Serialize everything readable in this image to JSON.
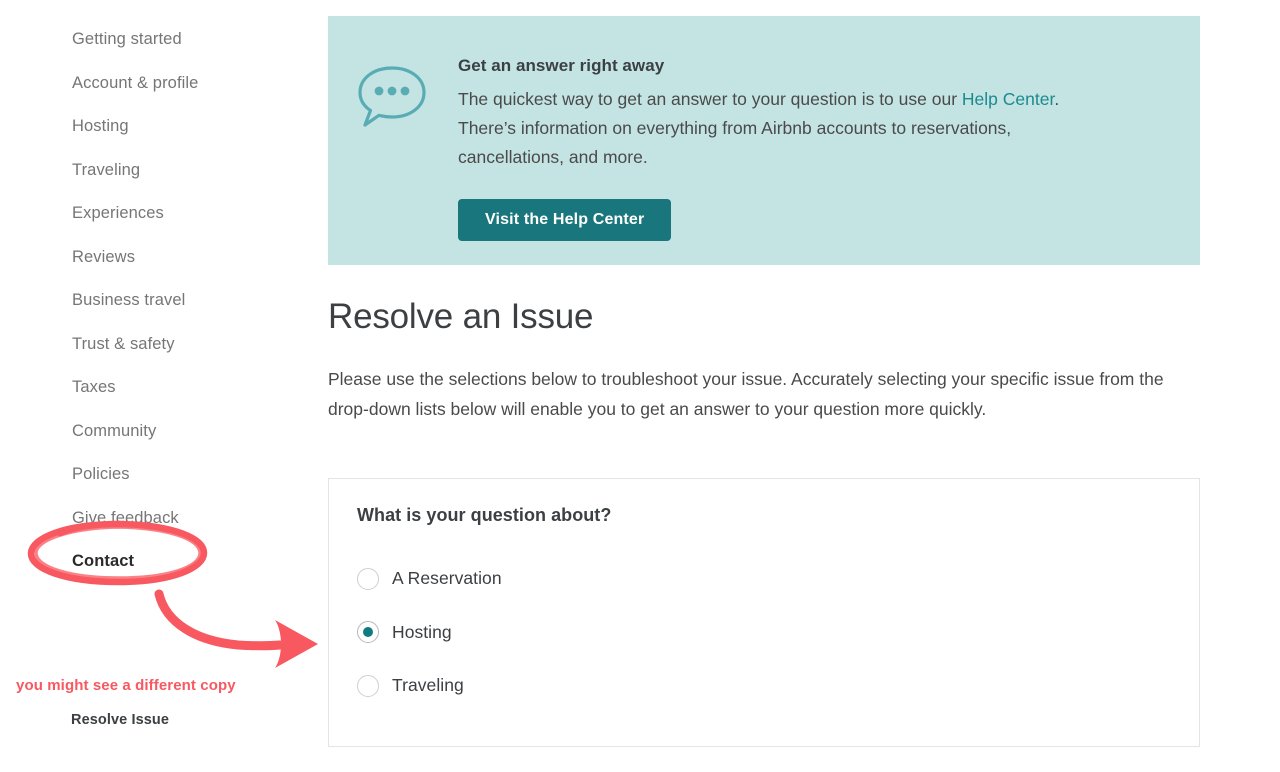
{
  "sidebar": {
    "items": [
      {
        "label": "Getting started",
        "active": false
      },
      {
        "label": "Account & profile",
        "active": false
      },
      {
        "label": "Hosting",
        "active": false
      },
      {
        "label": "Traveling",
        "active": false
      },
      {
        "label": "Experiences",
        "active": false
      },
      {
        "label": "Reviews",
        "active": false
      },
      {
        "label": "Business travel",
        "active": false
      },
      {
        "label": "Trust & safety",
        "active": false
      },
      {
        "label": "Taxes",
        "active": false
      },
      {
        "label": "Community",
        "active": false
      },
      {
        "label": "Policies",
        "active": false
      },
      {
        "label": "Give feedback",
        "active": false
      },
      {
        "label": "Contact",
        "active": true
      }
    ]
  },
  "annotations": {
    "color": "#f8585f",
    "note": "you might see a different copy",
    "sub_note": "Resolve Issue",
    "ellipse_target": "Contact",
    "arrow": "curved-arrow-right"
  },
  "banner": {
    "icon": "speech-bubble-ellipsis-icon",
    "background_color": "#c3e4e3",
    "title": "Get an answer right away",
    "text_before_link": "The quickest way to get an answer to your question is to use our ",
    "link_text": "Help Center",
    "text_after_link": ". There’s information on everything from Airbnb accounts to reservations, cancellations, and more.",
    "button_label": "Visit the Help Center",
    "button_color": "#19767c",
    "link_color": "#1d8a8f"
  },
  "main": {
    "title": "Resolve an Issue",
    "intro": "Please use the selections below to troubleshoot your issue. Accurately selecting your specific issue from the drop-down lists below will enable you to get an answer to your question more quickly."
  },
  "question_card": {
    "title": "What is your question about?",
    "selected_value": "Hosting",
    "options": [
      {
        "label": "A Reservation",
        "selected": false
      },
      {
        "label": "Hosting",
        "selected": true
      },
      {
        "label": "Traveling",
        "selected": false
      }
    ],
    "selected_dot_color": "#0f7b80"
  }
}
